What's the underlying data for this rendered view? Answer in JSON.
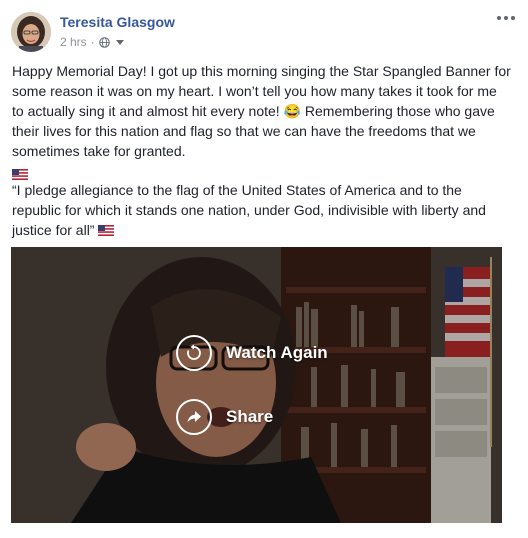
{
  "post": {
    "author": "Teresita Glasgow",
    "time": "2 hrs",
    "separator": "·",
    "privacy_icon": "globe-icon",
    "paragraph1": "Happy Memorial Day! I got up this morning singing the Star Spangled Banner for some reason it was on my heart. I won’t tell you how many takes it took for me to actually sing it and almost hit every note! 😂 Remembering those who gave their lives for this nation and flag so that we can have the freedoms that we sometimes take for granted.",
    "paragraph2": "“I pledge allegiance to the flag of the United States of America and to the republic for which it stands one nation, under God, indivisible with liberty and justice for all”"
  },
  "video": {
    "watch_again_label": "Watch Again",
    "share_label": "Share"
  },
  "colors": {
    "author_link": "#365899",
    "meta_text": "#90949c",
    "body_text": "#1d2129"
  }
}
